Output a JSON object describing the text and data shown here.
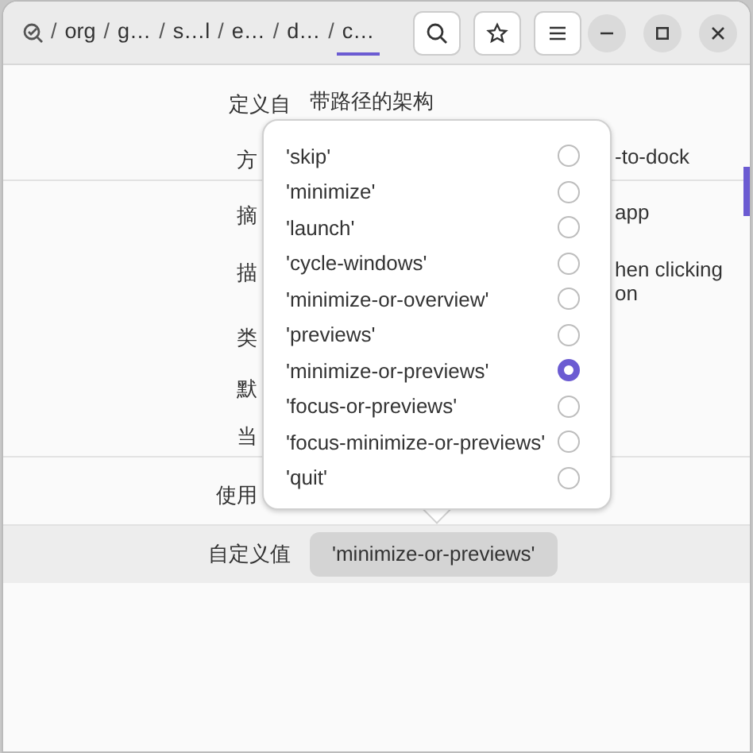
{
  "breadcrumb": [
    {
      "separator": "/",
      "label": "org",
      "selected": false
    },
    {
      "separator": "/",
      "label": "g…",
      "selected": false
    },
    {
      "separator": "/",
      "label": "s…l",
      "selected": false
    },
    {
      "separator": "/",
      "label": "e…",
      "selected": false
    },
    {
      "separator": "/",
      "label": "d…",
      "selected": false
    },
    {
      "separator": "/",
      "label": "c…",
      "selected": true
    }
  ],
  "sections": [
    {
      "rows": [
        {
          "label": "定义自",
          "value_lines": [
            "带路径的架构"
          ],
          "covered": false
        },
        {
          "label": "方",
          "value_lines": [
            "-to-dock"
          ],
          "covered": true
        }
      ]
    },
    {
      "rows": [
        {
          "label": "摘",
          "value_lines": [
            "app"
          ],
          "covered": true
        },
        {
          "label": "描",
          "value_lines": [
            "hen clicking",
            "on"
          ],
          "covered": true
        },
        {
          "label": "类",
          "value_lines": [],
          "covered": true
        },
        {
          "label": "默",
          "value_lines": [],
          "covered": true
        },
        {
          "label": "当",
          "value_lines": [],
          "covered": true
        }
      ]
    },
    {
      "rows": [
        {
          "label": "使用",
          "value_lines": [],
          "covered": true
        }
      ]
    }
  ],
  "custom_value": {
    "label": "自定义值",
    "value": "'minimize-or-previews'"
  },
  "options": [
    {
      "label": "'skip'",
      "selected": false
    },
    {
      "label": "'minimize'",
      "selected": false
    },
    {
      "label": "'launch'",
      "selected": false
    },
    {
      "label": "'cycle-windows'",
      "selected": false
    },
    {
      "label": "'minimize-or-overview'",
      "selected": false
    },
    {
      "label": "'previews'",
      "selected": false
    },
    {
      "label": "'minimize-or-previews'",
      "selected": true
    },
    {
      "label": "'focus-or-previews'",
      "selected": false
    },
    {
      "label": "'focus-minimize-or-previews'",
      "selected": false
    },
    {
      "label": "'quit'",
      "selected": false
    }
  ]
}
